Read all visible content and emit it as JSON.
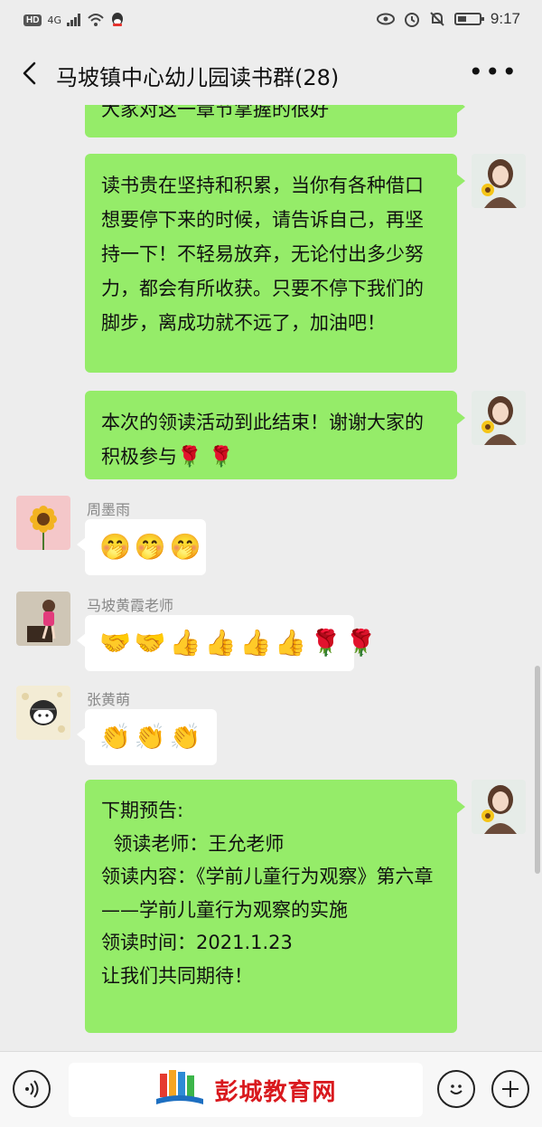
{
  "status_bar": {
    "hd": "HD",
    "network": "4G",
    "time": "9:17"
  },
  "header": {
    "title": "马坡镇中心幼儿园读书群(28)",
    "more_label": "•••"
  },
  "messages": [
    {
      "text": "大家对这一章节掌握的很好"
    },
    {
      "text": "读书贵在坚持和积累，当你有各种借口想要停下来的时候，请告诉自己，再坚持一下！不轻易放弃，无论付出多少努力，都会有所收获。只要不停下我们的脚步，离成功就不远了，加油吧！"
    },
    {
      "text": "本次的领读活动到此结束！谢谢大家的积极参与"
    },
    {
      "sender": "周墨雨"
    },
    {
      "sender": "马坡黄霞老师"
    },
    {
      "sender": "张黄萌"
    },
    {
      "text": "下期预告:\n  领读老师：王允老师\n领读内容：《学前儿童行为观察》第六章——学前儿童行为观察的实施\n领读时间：2021.1.23\n让我们共同期待！"
    }
  ],
  "input": {
    "brand": "彭城教育网"
  },
  "colors": {
    "my_bubble": "#95ec69",
    "other_bubble": "#ffffff",
    "background": "#ededed",
    "brand": "#d9191e"
  },
  "icons": [
    "back-icon",
    "more-icon",
    "voice-icon",
    "emoji-icon",
    "plus-icon"
  ]
}
